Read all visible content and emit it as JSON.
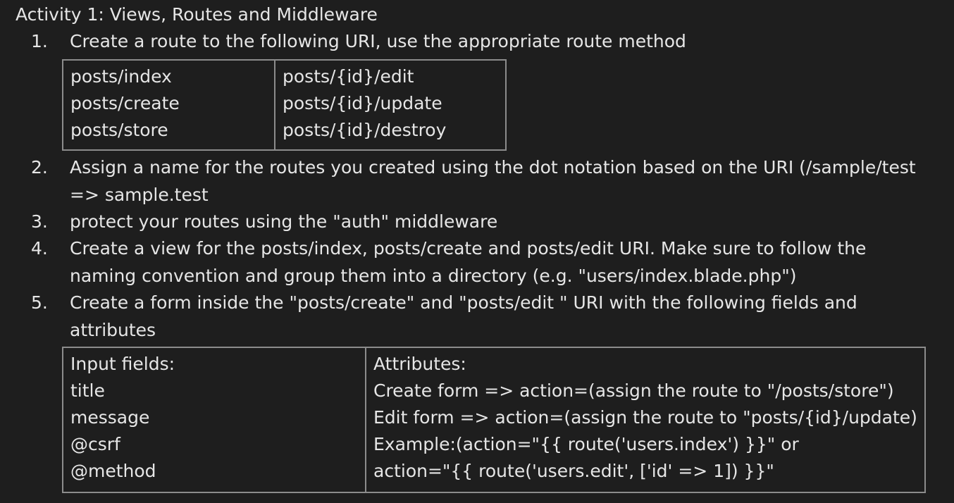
{
  "title": "Activity 1: Views, Routes and Middleware",
  "items": [
    {
      "number": "1.",
      "lines": [
        "Create a route to the following URI, use the appropriate route method"
      ]
    },
    {
      "number": "2.",
      "lines": [
        "Assign a name for the routes you created using the dot notation based on the URI (/sample/test",
        "=> sample.test"
      ]
    },
    {
      "number": "3.",
      "lines": [
        "protect your routes using the \"auth\" middleware"
      ]
    },
    {
      "number": "4.",
      "lines": [
        "Create a view for the posts/index, posts/create and posts/edit URI. Make sure to follow the",
        "naming convention and group them into a directory (e.g. \"users/index.blade.php\")"
      ]
    },
    {
      "number": "5.",
      "lines": [
        "Create a form inside the \"posts/create\" and \"posts/edit \" URI with the following fields and",
        "attributes"
      ]
    }
  ],
  "routes_table": {
    "left": [
      "posts/index",
      "posts/create",
      "posts/store"
    ],
    "right": [
      "posts/{id}/edit",
      "posts/{id}/update",
      "posts/{id}/destroy"
    ]
  },
  "fields_table": {
    "left": [
      "Input fields:",
      "title",
      "message",
      "@csrf",
      "@method"
    ],
    "right": [
      "Attributes:",
      "Create form => action=(assign the route to \"/posts/store\")",
      "Edit form => action=(assign the route to \"posts/{id}/update)",
      "Example:(action=\"{{ route('users.index') }}\" or",
      "action=\"{{ route('users.edit', ['id' => 1]) }}\""
    ]
  }
}
